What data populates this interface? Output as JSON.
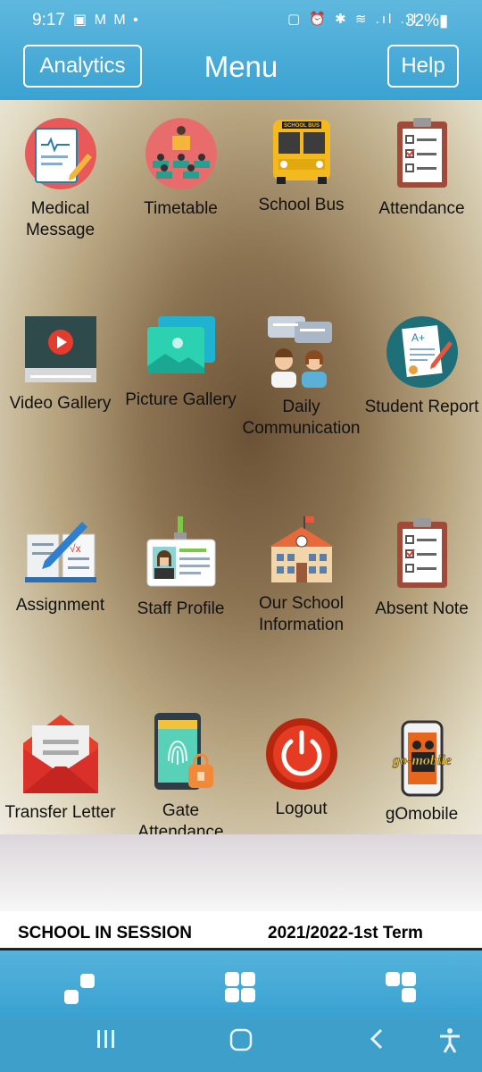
{
  "status_bar": {
    "time": "9:17",
    "notif_icons": "▣ M M •",
    "sys_icons": "▢ ⏰ ✱ ≋ .ıl .ıl",
    "battery": "32%▮"
  },
  "header": {
    "left_button": "Analytics",
    "title": "Menu",
    "right_button": "Help"
  },
  "menu": {
    "items": [
      {
        "label": "Medical Message",
        "icon": "medical-clipboard-icon"
      },
      {
        "label": "Timetable",
        "icon": "presentation-icon"
      },
      {
        "label": "School Bus",
        "icon": "school-bus-icon"
      },
      {
        "label": "Attendance",
        "icon": "checklist-clipboard-icon"
      },
      {
        "label": "Video Gallery",
        "icon": "video-play-icon"
      },
      {
        "label": "Picture Gallery",
        "icon": "picture-stack-icon"
      },
      {
        "label": "Daily Communication",
        "icon": "chat-people-icon"
      },
      {
        "label": "Student Report",
        "icon": "report-grade-icon"
      },
      {
        "label": "Assignment",
        "icon": "book-pencil-icon"
      },
      {
        "label": "Staff Profile",
        "icon": "id-badge-icon"
      },
      {
        "label": "Our School Information",
        "icon": "school-building-icon"
      },
      {
        "label": "Absent Note",
        "icon": "checklist-clipboard-icon"
      },
      {
        "label": "Transfer Letter",
        "icon": "envelope-icon"
      },
      {
        "label": "Gate Attendance",
        "icon": "fingerprint-lock-icon"
      },
      {
        "label": "Logout",
        "icon": "power-icon"
      },
      {
        "label": "gOmobile",
        "icon": "phone-logo-icon"
      }
    ],
    "gomobile_logo_text": "go-mobile",
    "bus_sign_text": "SCHOOL BUS"
  },
  "session": {
    "status": "SCHOOL IN SESSION",
    "term": "2021/2022-1st Term"
  }
}
